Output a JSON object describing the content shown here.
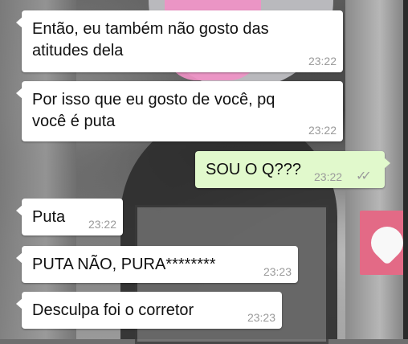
{
  "messages": [
    {
      "text": "Então, eu também não gosto das\natitudes dela",
      "time": "23:22"
    },
    {
      "text": "Por isso que eu gosto de você, pq\nvocê é puta",
      "time": "23:22"
    },
    {
      "text": "SOU O Q???",
      "time": "23:22",
      "status_icon": "double-check-icon",
      "status_glyph": "✓✓"
    },
    {
      "text": "Puta",
      "time": "23:22"
    },
    {
      "text": "PUTA NÃO, PURA********",
      "time": "23:23"
    },
    {
      "text": "Desculpa foi o corretor",
      "time": "23:23"
    }
  ],
  "colors": {
    "incoming_bubble": "#ffffff",
    "outgoing_bubble": "#e1f9cc",
    "timestamp": "#9a9a9a"
  }
}
